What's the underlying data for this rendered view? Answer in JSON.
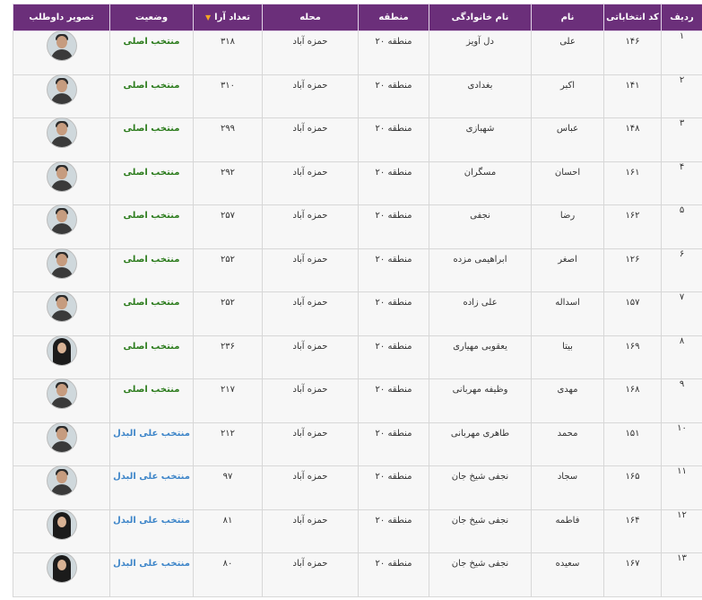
{
  "table": {
    "headers": {
      "row": "ردیف",
      "code": "کد انتخاباتی",
      "first": "نام",
      "last": "نام خانوادگی",
      "zone": "منطقه",
      "district": "محله",
      "votes": "تعداد آرا",
      "status": "وضعیت",
      "photo": "تصویر داوطلب"
    },
    "sort_icon": "sort-down-triangle-icon",
    "colors": {
      "header_bg": "#6b2f7a",
      "status_main": "#2e7d1f",
      "status_alt": "#3f86c9"
    },
    "rows": [
      {
        "row": "۱",
        "code": "۱۴۶",
        "first": "علی",
        "last": "دل آویز",
        "zone": "منطقه ۲۰",
        "district": "حمزه آباد",
        "votes": "۳۱۸",
        "status": "منتخب اصلی",
        "kind": "main",
        "gender": "m"
      },
      {
        "row": "۲",
        "code": "۱۴۱",
        "first": "اکبر",
        "last": "بغدادی",
        "zone": "منطقه ۲۰",
        "district": "حمزه آباد",
        "votes": "۳۱۰",
        "status": "منتخب اصلی",
        "kind": "main",
        "gender": "m"
      },
      {
        "row": "۳",
        "code": "۱۴۸",
        "first": "عباس",
        "last": "شهبازی",
        "zone": "منطقه ۲۰",
        "district": "حمزه آباد",
        "votes": "۲۹۹",
        "status": "منتخب اصلی",
        "kind": "main",
        "gender": "m"
      },
      {
        "row": "۴",
        "code": "۱۶۱",
        "first": "احسان",
        "last": "مسگران",
        "zone": "منطقه ۲۰",
        "district": "حمزه آباد",
        "votes": "۲۹۲",
        "status": "منتخب اصلی",
        "kind": "main",
        "gender": "m"
      },
      {
        "row": "۵",
        "code": "۱۶۲",
        "first": "رضا",
        "last": "نجفی",
        "zone": "منطقه ۲۰",
        "district": "حمزه آباد",
        "votes": "۲۵۷",
        "status": "منتخب اصلی",
        "kind": "main",
        "gender": "m"
      },
      {
        "row": "۶",
        "code": "۱۲۶",
        "first": "اصغر",
        "last": "ابراهیمی مزده",
        "zone": "منطقه ۲۰",
        "district": "حمزه آباد",
        "votes": "۲۵۲",
        "status": "منتخب اصلی",
        "kind": "main",
        "gender": "m"
      },
      {
        "row": "۷",
        "code": "۱۵۷",
        "first": "اسداله",
        "last": "علی زاده",
        "zone": "منطقه ۲۰",
        "district": "حمزه آباد",
        "votes": "۲۵۲",
        "status": "منتخب اصلی",
        "kind": "main",
        "gender": "m"
      },
      {
        "row": "۸",
        "code": "۱۶۹",
        "first": "بیتا",
        "last": "یعقوبی مهیاری",
        "zone": "منطقه ۲۰",
        "district": "حمزه آباد",
        "votes": "۲۳۶",
        "status": "منتخب اصلی",
        "kind": "main",
        "gender": "f"
      },
      {
        "row": "۹",
        "code": "۱۶۸",
        "first": "مهدی",
        "last": "وظیفه مهربانی",
        "zone": "منطقه ۲۰",
        "district": "حمزه آباد",
        "votes": "۲۱۷",
        "status": "منتخب اصلی",
        "kind": "main",
        "gender": "m"
      },
      {
        "row": "۱۰",
        "code": "۱۵۱",
        "first": "محمد",
        "last": "طاهری مهربانی",
        "zone": "منطقه ۲۰",
        "district": "حمزه آباد",
        "votes": "۲۱۲",
        "status": "منتخب علی البدل",
        "kind": "alt",
        "gender": "m"
      },
      {
        "row": "۱۱",
        "code": "۱۶۵",
        "first": "سجاد",
        "last": "نجفی شیخ جان",
        "zone": "منطقه ۲۰",
        "district": "حمزه آباد",
        "votes": "۹۷",
        "status": "منتخب علی البدل",
        "kind": "alt",
        "gender": "m"
      },
      {
        "row": "۱۲",
        "code": "۱۶۴",
        "first": "فاطمه",
        "last": "نجفی شیخ جان",
        "zone": "منطقه ۲۰",
        "district": "حمزه آباد",
        "votes": "۸۱",
        "status": "منتخب علی البدل",
        "kind": "alt",
        "gender": "f"
      },
      {
        "row": "۱۳",
        "code": "۱۶۷",
        "first": "سعیده",
        "last": "نجفی شیخ جان",
        "zone": "منطقه ۲۰",
        "district": "حمزه آباد",
        "votes": "۸۰",
        "status": "منتخب علی البدل",
        "kind": "alt",
        "gender": "f"
      }
    ]
  }
}
